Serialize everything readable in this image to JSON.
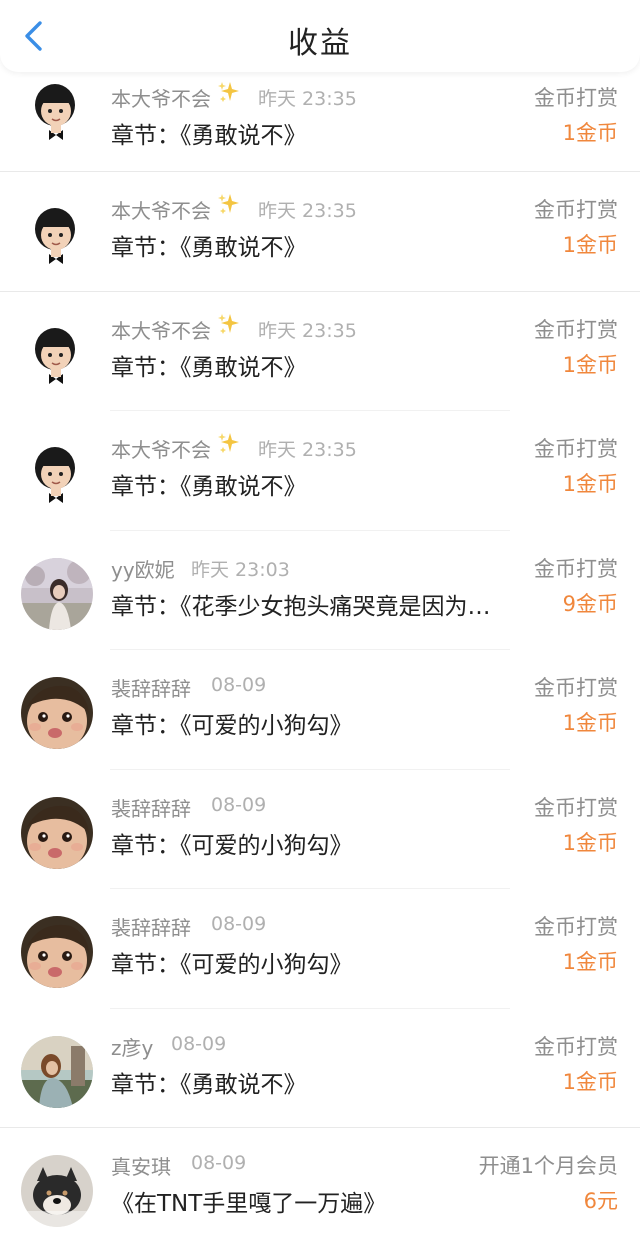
{
  "header": {
    "title": "收益",
    "back_icon": "chevron-left-icon",
    "accent": "#3a8ee6"
  },
  "colors": {
    "amount": "#f0873c",
    "meta": "#8e8e8e",
    "time": "#b0b0b0"
  },
  "records": [
    {
      "avatar": "boy-cartoon",
      "name": "本大爷不会",
      "sparkle": true,
      "time": "昨天 23:35",
      "content": "章节：《勇敢说不》",
      "type": "金币打赏",
      "amount": "1金币"
    },
    {
      "avatar": "boy-cartoon",
      "name": "本大爷不会",
      "sparkle": true,
      "time": "昨天 23:35",
      "content": "章节：《勇敢说不》",
      "type": "金币打赏",
      "amount": "1金币"
    },
    {
      "avatar": "boy-cartoon",
      "name": "本大爷不会",
      "sparkle": true,
      "time": "昨天 23:35",
      "content": "章节：《勇敢说不》",
      "type": "金币打赏",
      "amount": "1金币"
    },
    {
      "avatar": "boy-cartoon",
      "name": "本大爷不会",
      "sparkle": true,
      "time": "昨天 23:35",
      "content": "章节：《勇敢说不》",
      "type": "金币打赏",
      "amount": "1金币"
    },
    {
      "avatar": "girl-photo",
      "name": "yy欧妮",
      "sparkle": false,
      "time": "昨天 23:03",
      "content": "章节：《花季少女抱头痛哭竟是因为…",
      "type": "金币打赏",
      "amount": "9金币"
    },
    {
      "avatar": "baby-photo",
      "name": "裴辞辞辞",
      "sparkle": false,
      "time": "08-09",
      "content": "章节：《可爱的小狗勾》",
      "type": "金币打赏",
      "amount": "1金币"
    },
    {
      "avatar": "baby-photo",
      "name": "裴辞辞辞",
      "sparkle": false,
      "time": "08-09",
      "content": "章节：《可爱的小狗勾》",
      "type": "金币打赏",
      "amount": "1金币"
    },
    {
      "avatar": "baby-photo",
      "name": "裴辞辞辞",
      "sparkle": false,
      "time": "08-09",
      "content": "章节：《可爱的小狗勾》",
      "type": "金币打赏",
      "amount": "1金币"
    },
    {
      "avatar": "woman-photo",
      "name": "z彦y",
      "sparkle": false,
      "time": "08-09",
      "content": "章节：《勇敢说不》",
      "type": "金币打赏",
      "amount": "1金币"
    },
    {
      "avatar": "dog-photo",
      "name": "真安琪",
      "sparkle": false,
      "time": "08-09",
      "content": "《在TNT手里嘎了一万遍》",
      "type": "开通1个月会员",
      "amount": "6元"
    }
  ]
}
